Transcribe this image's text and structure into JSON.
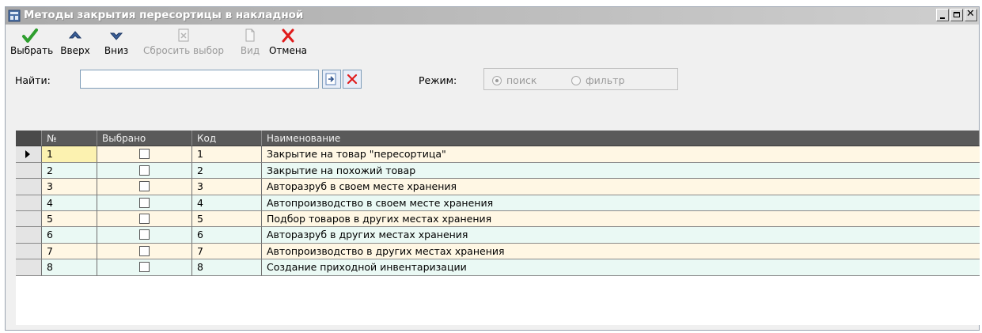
{
  "window": {
    "title": "Методы закрытия пересортицы в накладной",
    "icon": "app-icon",
    "controls": [
      "minimize-icon",
      "maximize-icon",
      "close-icon"
    ]
  },
  "toolbar": {
    "select_label": "Выбрать",
    "up_label": "Вверх",
    "down_label": "Вниз",
    "reset_label": "Сбросить выбор",
    "view_label": "Вид",
    "cancel_label": "Отмена"
  },
  "search": {
    "label": "Найти:",
    "value": "",
    "mode_label": "Режим:",
    "mode_options": [
      "поиск",
      "фильтр"
    ],
    "mode_selected": "поиск"
  },
  "table": {
    "headers": [
      "№",
      "Выбрано",
      "Код",
      "Наименование"
    ],
    "current_row": 1,
    "rows": [
      {
        "num": "1",
        "selected": false,
        "code": "1",
        "name": "Закрытие на товар \"пересортица\""
      },
      {
        "num": "2",
        "selected": false,
        "code": "2",
        "name": "Закрытие на похожий товар"
      },
      {
        "num": "3",
        "selected": false,
        "code": "3",
        "name": "Авторазруб в своем месте хранения"
      },
      {
        "num": "4",
        "selected": false,
        "code": "4",
        "name": "Автопроизводство в своем месте хранения"
      },
      {
        "num": "5",
        "selected": false,
        "code": "5",
        "name": "Подбор товаров в других местах хранения"
      },
      {
        "num": "6",
        "selected": false,
        "code": "6",
        "name": "Авторазруб в других местах хранения"
      },
      {
        "num": "7",
        "selected": false,
        "code": "7",
        "name": "Автопроизводство в других местах хранения"
      },
      {
        "num": "8",
        "selected": false,
        "code": "8",
        "name": "Создание приходной инвентаризации"
      }
    ]
  },
  "colors": {
    "row_odd": "#fff7e4",
    "row_even": "#eaf9f4",
    "header": "#5a5a5a",
    "accept": "#2e9e2e",
    "cancel": "#e01b1b"
  }
}
